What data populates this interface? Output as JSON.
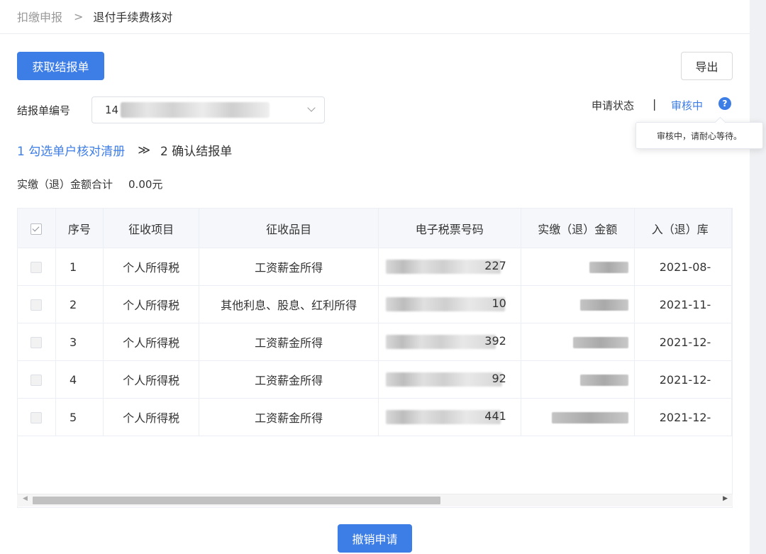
{
  "breadcrumb": {
    "root": "扣缴申报",
    "separator": ">",
    "current": "退付手续费核对"
  },
  "toolbar": {
    "fetch_button": "获取结报单",
    "export_button": "导出"
  },
  "report_select": {
    "label": "结报单编号",
    "value_prefix": "14"
  },
  "status": {
    "label": "申请状态",
    "separator": "|",
    "value": "审核中",
    "help_icon": "?",
    "tooltip": "审核中，请耐心等待。"
  },
  "steps": {
    "step1": "1 勾选单户核对清册",
    "arrow": "≫",
    "step2": "2 确认结报单"
  },
  "total": {
    "label": "实缴（退）金额合计",
    "value": "0.00元"
  },
  "table": {
    "headers": [
      "序号",
      "征收项目",
      "征收品目",
      "电子税票号码",
      "实缴（退）金额",
      "入（退）库"
    ],
    "rows": [
      {
        "no": "1",
        "item": "个人所得税",
        "category": "工资薪金所得",
        "ticket_tail": "227",
        "date": "2021-08-"
      },
      {
        "no": "2",
        "item": "个人所得税",
        "category": "其他利息、股息、红利所得",
        "ticket_tail": "10",
        "date": "2021-11-"
      },
      {
        "no": "3",
        "item": "个人所得税",
        "category": "工资薪金所得",
        "ticket_tail": "392",
        "date": "2021-12-"
      },
      {
        "no": "4",
        "item": "个人所得税",
        "category": "工资薪金所得",
        "ticket_tail": "92",
        "date": "2021-12-"
      },
      {
        "no": "5",
        "item": "个人所得税",
        "category": "工资薪金所得",
        "ticket_tail": "441",
        "date": "2021-12-"
      }
    ]
  },
  "footer": {
    "revoke_button": "撤销申请"
  },
  "colors": {
    "primary": "#3d7de6",
    "header_bg": "#f5f7fa",
    "border": "#ebeef5"
  },
  "icons": {
    "breadcrumb_separator": "chevron-right-icon",
    "select_arrow": "chevron-down-icon",
    "help": "question-circle-icon",
    "steps_arrow": "double-chevron-right-icon"
  }
}
